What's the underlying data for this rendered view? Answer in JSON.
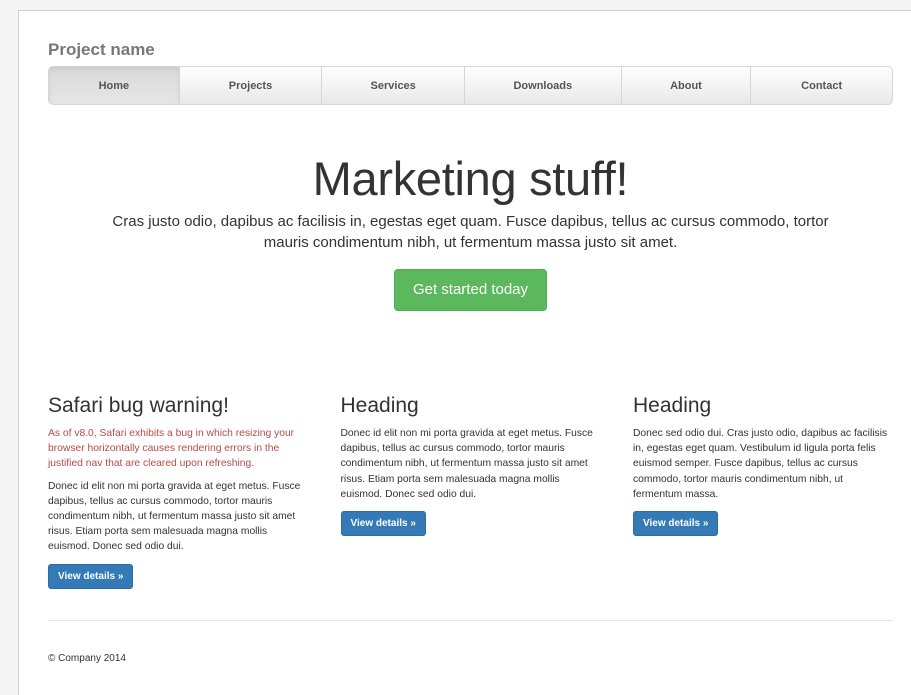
{
  "brand": "Project name",
  "nav": {
    "items": [
      {
        "label": "Home"
      },
      {
        "label": "Projects"
      },
      {
        "label": "Services"
      },
      {
        "label": "Downloads"
      },
      {
        "label": "About"
      },
      {
        "label": "Contact"
      }
    ],
    "active": "Home"
  },
  "jumbotron": {
    "heading": "Marketing stuff!",
    "lead": "Cras justo odio, dapibus ac facilisis in, egestas eget quam. Fusce dapibus, tellus ac cursus commodo, tortor mauris condimentum nibh, ut fermentum massa justo sit amet.",
    "cta_label": "Get started today"
  },
  "columns": [
    {
      "heading": "Safari bug warning!",
      "warning": "As of v8.0, Safari exhibits a bug in which resizing your browser horizontally causes rendering errors in the justified nav that are cleared upon refreshing.",
      "body": "Donec id elit non mi porta gravida at eget metus. Fusce dapibus, tellus ac cursus commodo, tortor mauris condimentum nibh, ut fermentum massa justo sit amet risus. Etiam porta sem malesuada magna mollis euismod. Donec sed odio dui.",
      "button": "View details »"
    },
    {
      "heading": "Heading",
      "body": "Donec id elit non mi porta gravida at eget metus. Fusce dapibus, tellus ac cursus commodo, tortor mauris condimentum nibh, ut fermentum massa justo sit amet risus. Etiam porta sem malesuada magna mollis euismod. Donec sed odio dui.",
      "button": "View details »"
    },
    {
      "heading": "Heading",
      "body": "Donec sed odio dui. Cras justo odio, dapibus ac facilisis in, egestas eget quam. Vestibulum id ligula porta felis euismod semper. Fusce dapibus, tellus ac cursus commodo, tortor mauris condimentum nibh, ut fermentum massa.",
      "button": "View details »"
    }
  ],
  "footer": "© Company 2014",
  "colors": {
    "success": "#5cb85c",
    "primary": "#337ab7",
    "warning_text": "#b94a48"
  }
}
